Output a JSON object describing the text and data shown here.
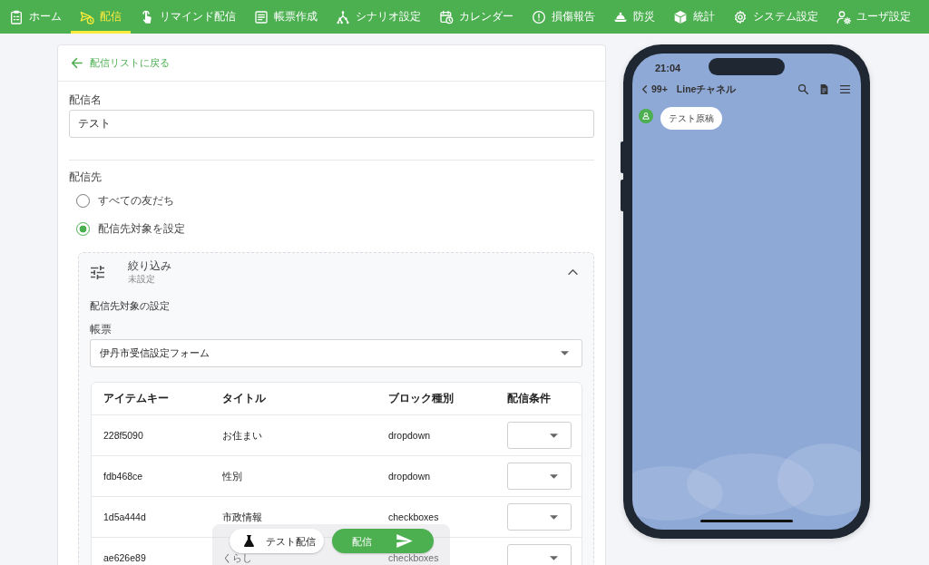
{
  "nav": {
    "items": [
      {
        "label": "ホーム",
        "selected": false
      },
      {
        "label": "配信",
        "selected": true
      },
      {
        "label": "リマインド配信",
        "selected": false
      },
      {
        "label": "帳票作成",
        "selected": false
      },
      {
        "label": "シナリオ設定",
        "selected": false
      },
      {
        "label": "カレンダー",
        "selected": false
      },
      {
        "label": "損傷報告",
        "selected": false
      },
      {
        "label": "防災",
        "selected": false
      },
      {
        "label": "統計",
        "selected": false
      },
      {
        "label": "システム設定",
        "selected": false
      },
      {
        "label": "ユーザ設定",
        "selected": false
      }
    ]
  },
  "back_link": {
    "label": "配信リストに戻る"
  },
  "name_field": {
    "label": "配信名",
    "value": "テスト"
  },
  "recipients": {
    "label": "配信先",
    "options": [
      {
        "label": "すべての友だち",
        "selected": false
      },
      {
        "label": "配信先対象を設定",
        "selected": true
      }
    ]
  },
  "filter": {
    "title": "絞り込み",
    "subtitle": "未設定",
    "expanded": true,
    "section_title": "配信先対象の設定",
    "form_select": {
      "label": "帳票",
      "value": "伊丹市受信設定フォーム"
    },
    "table": {
      "columns": [
        "アイテムキー",
        "タイトル",
        "ブロック種別",
        "配信条件"
      ],
      "rows": [
        {
          "item_key": "228f5090",
          "title": "お住まい",
          "block_type": "dropdown"
        },
        {
          "item_key": "fdb468ce",
          "title": "性別",
          "block_type": "dropdown"
        },
        {
          "item_key": "1d5a444d",
          "title": "市政情報",
          "block_type": "checkboxes"
        },
        {
          "item_key": "ae626e89",
          "title": "くらし",
          "block_type": "checkboxes"
        }
      ]
    }
  },
  "action_bar": {
    "buttons": [
      {
        "label": "テスト配信",
        "kind": "secondary"
      },
      {
        "label": "配信",
        "kind": "primary"
      }
    ]
  },
  "phone": {
    "time": "21:04",
    "unread_count": "99+",
    "channel_name": "Lineチャネル",
    "messages": [
      {
        "text": "テスト原稿"
      }
    ]
  }
}
